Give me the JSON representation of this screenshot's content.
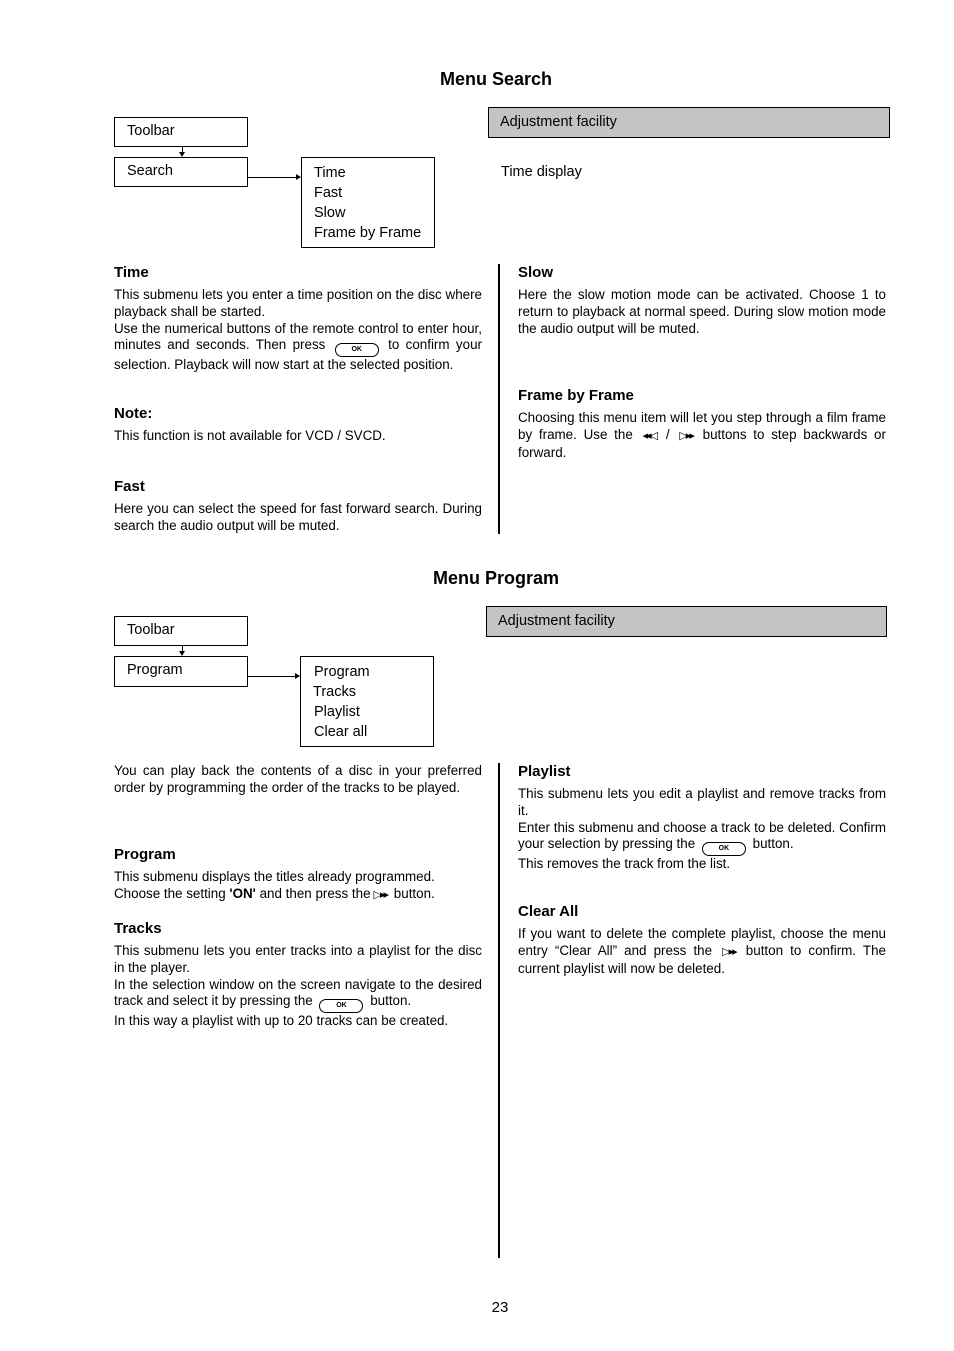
{
  "menu_search": {
    "title": "Menu Search",
    "diagram": {
      "toolbar_label": "Toolbar",
      "menu_label": "Search",
      "submenu_items": [
        "Time",
        "Fast",
        "Slow",
        "Frame by Frame"
      ]
    },
    "adjustment_header": "Adjustment facility",
    "adjustment_value": "Time display",
    "sections": {
      "time": {
        "heading": "Time",
        "p1": "This submenu lets you enter a time position on the disc where playback shall be started.",
        "p2_before": "Use the numerical buttons of the remote control to enter hour, minutes and seconds. Then press",
        "p2_after": "to confirm your selection. Playback will now start at the selected position."
      },
      "note": {
        "heading": "Note:",
        "text": "This function is not available for VCD / SVCD."
      },
      "fast": {
        "heading": "Fast",
        "text": "Here you can select the speed for fast forward search. During search the audio output will be muted."
      },
      "slow": {
        "heading": "Slow",
        "text": "Here the slow motion mode can be activated. Choose 1 to return to playback at normal speed. During slow motion mode the audio output will be muted."
      },
      "frame": {
        "heading": "Frame by Frame",
        "text_before": "Choosing this menu item will let you step through a film frame by frame. Use the",
        "separator": "/",
        "text_after": "buttons to step backwards or forward."
      }
    }
  },
  "menu_program": {
    "title": "Menu Program",
    "diagram": {
      "toolbar_label": "Toolbar",
      "menu_label": "Program",
      "submenu_items": [
        "Program",
        "Tracks",
        "Playlist",
        "Clear all"
      ]
    },
    "adjustment_header": "Adjustment facility",
    "sections": {
      "intro": {
        "text": "You can play back the contents of a disc in your preferred order by programming the order of the tracks to be played."
      },
      "program": {
        "heading": "Program",
        "line1": "This submenu displays the titles already programmed.",
        "line2_before": "Choose the setting",
        "line2_bold": "'ON'",
        "line2_mid": "and then press the",
        "line2_after": "button."
      },
      "tracks": {
        "heading": "Tracks",
        "p1": "This submenu lets you enter tracks into a playlist for the disc in the player.",
        "p2_before": "In the selection window on the screen navigate to the desired track and select it by pressing the",
        "p2_after": "button.",
        "p3": "In this way a playlist with up to 20 tracks can be created."
      },
      "playlist": {
        "heading": "Playlist",
        "p1": "This submenu lets you edit a playlist and remove tracks from it.",
        "p2_before": "Enter this submenu and choose a track to be deleted. Confirm your selection by pressing the",
        "p2_after": "button.",
        "p3": "This removes the track from the list."
      },
      "clear_all": {
        "heading": "Clear All",
        "text_before": "If you want to delete the complete playlist, choose the menu entry “Clear All” and press the",
        "text_after": "button to confirm. The current playlist will now be deleted."
      }
    }
  },
  "buttons": {
    "ok_label": "OK",
    "rewind_glyph": "◂◂◁",
    "forward_glyph": "▷▸▸"
  },
  "page_number": "23"
}
